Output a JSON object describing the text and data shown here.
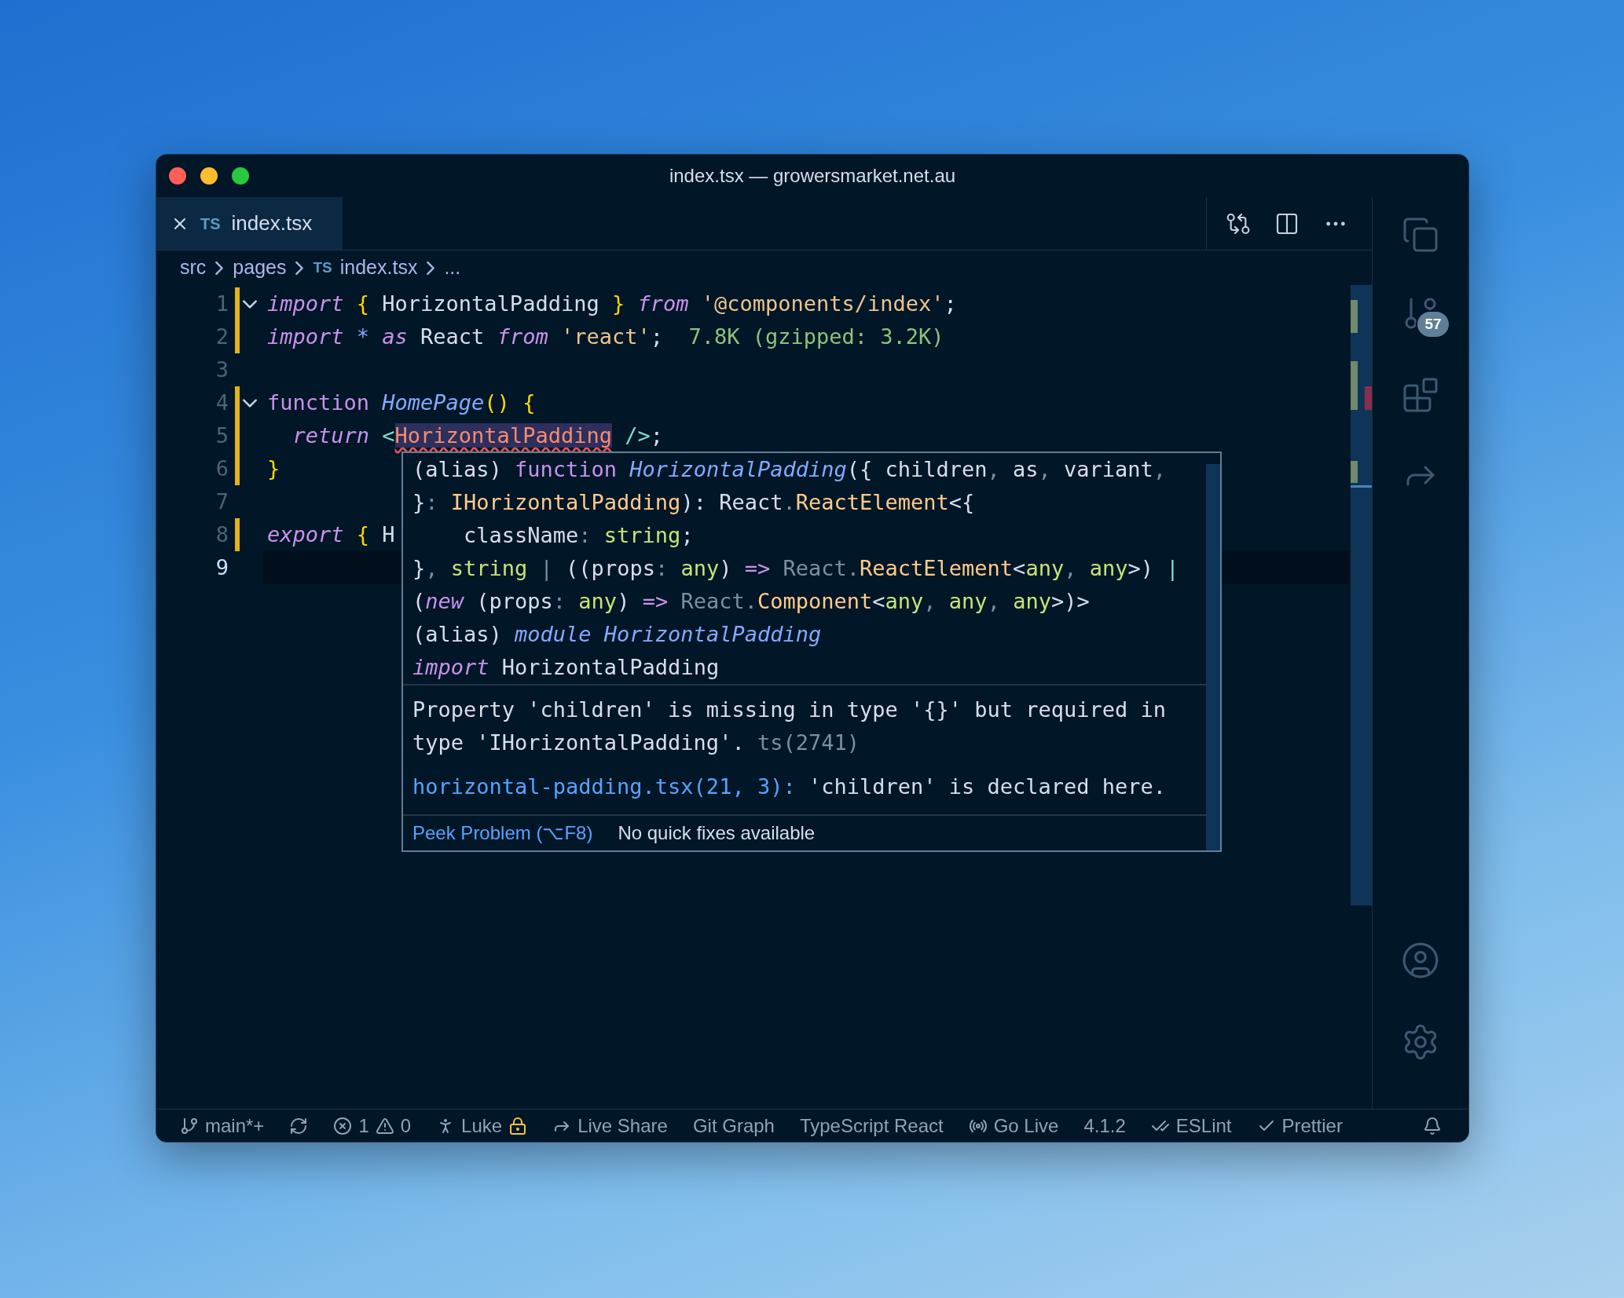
{
  "window": {
    "title": "index.tsx — growersmarket.net.au"
  },
  "tabs": [
    {
      "badge": "TS",
      "label": "index.tsx",
      "selected": true
    }
  ],
  "breadcrumb": [
    {
      "label": "src"
    },
    {
      "label": "pages"
    },
    {
      "badge": "TS",
      "label": "index.tsx"
    },
    {
      "label": "..."
    }
  ],
  "editor": {
    "lines": [
      {
        "number": "1",
        "foldable": true,
        "modified": true,
        "current": false,
        "tokens": [
          {
            "kind": "keyword-italic",
            "text": "import "
          },
          {
            "kind": "brace",
            "text": "{"
          },
          {
            "kind": "plain",
            "text": " HorizontalPadding "
          },
          {
            "kind": "brace",
            "text": "}"
          },
          {
            "kind": "keyword-italic",
            "text": " from "
          },
          {
            "kind": "string",
            "text": "'@components/index'"
          },
          {
            "kind": "plain",
            "text": ";"
          }
        ]
      },
      {
        "number": "2",
        "foldable": false,
        "modified": true,
        "current": false,
        "tokens": [
          {
            "kind": "keyword-italic",
            "text": "import "
          },
          {
            "kind": "symbol",
            "text": "*"
          },
          {
            "kind": "keyword-italic",
            "text": " as"
          },
          {
            "kind": "plain",
            "text": " React "
          },
          {
            "kind": "keyword-italic",
            "text": "from "
          },
          {
            "kind": "string",
            "text": "'react'"
          },
          {
            "kind": "plain",
            "text": ";  "
          },
          {
            "kind": "hint",
            "text": "7.8K (gzipped: 3.2K)"
          }
        ]
      },
      {
        "number": "3",
        "foldable": false,
        "modified": false,
        "current": false
      },
      {
        "number": "4",
        "foldable": true,
        "modified": true,
        "current": false,
        "tokens": [
          {
            "kind": "keyword",
            "text": "function "
          },
          {
            "kind": "function",
            "text": "HomePage"
          },
          {
            "kind": "brace",
            "text": "()"
          },
          {
            "kind": "brace",
            "text": " {"
          }
        ]
      },
      {
        "number": "5",
        "foldable": false,
        "modified": true,
        "current": false,
        "tokens": [
          {
            "kind": "keyword-italic",
            "text": "  return "
          },
          {
            "kind": "operator",
            "text": "<"
          },
          {
            "kind": "error-tag",
            "text": "HorizontalPadding"
          },
          {
            "kind": "operator",
            "text": " />"
          },
          {
            "kind": "plain",
            "text": ";"
          }
        ]
      },
      {
        "number": "6",
        "foldable": false,
        "modified": true,
        "current": false,
        "tokens": [
          {
            "kind": "brace",
            "text": "}"
          }
        ]
      },
      {
        "number": "7",
        "foldable": false,
        "modified": false,
        "current": false
      },
      {
        "number": "8",
        "foldable": false,
        "modified": true,
        "current": false,
        "tokens": [
          {
            "kind": "keyword-italic",
            "text": "export "
          },
          {
            "kind": "brace",
            "text": "{"
          },
          {
            "kind": "plain",
            "text": " H"
          }
        ]
      },
      {
        "number": "9",
        "foldable": false,
        "modified": false,
        "current": true
      }
    ]
  },
  "hover": {
    "signature": [
      [
        {
          "kind": "plain",
          "text": "(alias) "
        },
        {
          "kind": "keyword",
          "text": "function "
        },
        {
          "kind": "function",
          "text": "HorizontalPadding"
        },
        {
          "kind": "plain",
          "text": "({ children"
        },
        {
          "kind": "muted",
          "text": ", "
        },
        {
          "kind": "plain",
          "text": "as"
        },
        {
          "kind": "muted",
          "text": ", "
        },
        {
          "kind": "plain",
          "text": "variant"
        },
        {
          "kind": "muted",
          "text": ","
        }
      ],
      [
        {
          "kind": "plain",
          "text": "}"
        },
        {
          "kind": "muted",
          "text": ": "
        },
        {
          "kind": "type",
          "text": "IHorizontalPadding"
        },
        {
          "kind": "plain",
          "text": "): React"
        },
        {
          "kind": "muted",
          "text": "."
        },
        {
          "kind": "type",
          "text": "ReactElement"
        },
        {
          "kind": "plain",
          "text": "<{"
        }
      ],
      [
        {
          "kind": "plain",
          "text": "    className"
        },
        {
          "kind": "muted",
          "text": ": "
        },
        {
          "kind": "primitive",
          "text": "string"
        },
        {
          "kind": "plain",
          "text": ";"
        }
      ],
      [
        {
          "kind": "plain",
          "text": "}"
        },
        {
          "kind": "muted",
          "text": ", "
        },
        {
          "kind": "primitive",
          "text": "string"
        },
        {
          "kind": "muted",
          "text": " | "
        },
        {
          "kind": "plain",
          "text": "((props"
        },
        {
          "kind": "muted",
          "text": ": "
        },
        {
          "kind": "primitive",
          "text": "any"
        },
        {
          "kind": "plain",
          "text": ") "
        },
        {
          "kind": "keyword",
          "text": "=>"
        },
        {
          "kind": "muted",
          "text": " React."
        },
        {
          "kind": "type",
          "text": "ReactElement"
        },
        {
          "kind": "plain",
          "text": "<"
        },
        {
          "kind": "primitive",
          "text": "any"
        },
        {
          "kind": "muted",
          "text": ", "
        },
        {
          "kind": "primitive",
          "text": "any"
        },
        {
          "kind": "plain",
          "text": ">) "
        },
        {
          "kind": "operator",
          "text": "|"
        }
      ],
      [
        {
          "kind": "plain",
          "text": "("
        },
        {
          "kind": "keyword-italic",
          "text": "new"
        },
        {
          "kind": "plain",
          "text": " (props"
        },
        {
          "kind": "muted",
          "text": ": "
        },
        {
          "kind": "primitive",
          "text": "any"
        },
        {
          "kind": "plain",
          "text": ") "
        },
        {
          "kind": "keyword",
          "text": "=>"
        },
        {
          "kind": "muted",
          "text": " React."
        },
        {
          "kind": "type",
          "text": "Component"
        },
        {
          "kind": "plain",
          "text": "<"
        },
        {
          "kind": "primitive",
          "text": "any"
        },
        {
          "kind": "muted",
          "text": ", "
        },
        {
          "kind": "primitive",
          "text": "any"
        },
        {
          "kind": "muted",
          "text": ", "
        },
        {
          "kind": "primitive",
          "text": "any"
        },
        {
          "kind": "plain",
          "text": ">)>"
        }
      ],
      [
        {
          "kind": "plain",
          "text": "(alias) "
        },
        {
          "kind": "function",
          "text": "module HorizontalPadding"
        }
      ],
      [
        {
          "kind": "keyword-italic",
          "text": "import"
        },
        {
          "kind": "plain",
          "text": " HorizontalPadding"
        }
      ]
    ],
    "message": "Property 'children' is missing in type '{}' but required in type 'IHorizontalPadding'.",
    "code": "ts(2741)",
    "related_link": "horizontal-padding.tsx(21, 3):",
    "related_text": "'children' is declared here.",
    "actions": [
      {
        "kind": "link",
        "label": "Peek Problem (⌥F8)"
      },
      {
        "kind": "text",
        "label": "No quick fixes available"
      }
    ]
  },
  "activity_bar": {
    "badge": "57"
  },
  "status_bar": [
    {
      "kind": "branch",
      "label": "main*+"
    },
    {
      "kind": "sync"
    },
    {
      "kind": "problems",
      "errors": "1",
      "warnings": "0"
    },
    {
      "kind": "user",
      "label": "Luke"
    },
    {
      "kind": "live-share",
      "label": "Live Share"
    },
    {
      "kind": "text",
      "label": "Git Graph"
    },
    {
      "kind": "text",
      "label": "TypeScript React"
    },
    {
      "kind": "go-live",
      "label": "Go Live"
    },
    {
      "kind": "text",
      "label": "4.1.2"
    },
    {
      "kind": "eslint",
      "label": "ESLint"
    },
    {
      "kind": "prettier",
      "label": "Prettier"
    },
    {
      "kind": "bell"
    }
  ]
}
